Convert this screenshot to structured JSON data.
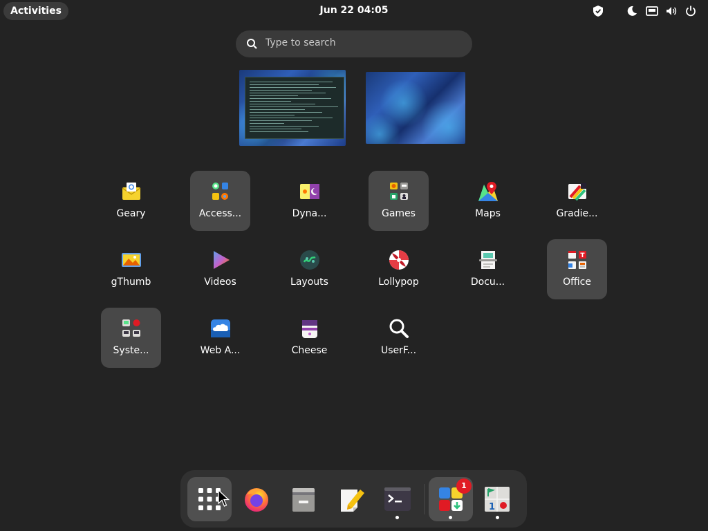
{
  "topbar": {
    "activities_label": "Activities",
    "clock": "Jun 22  04:05",
    "tray_icons": [
      "shield-icon",
      "night-light-icon",
      "network-icon",
      "volume-icon",
      "power-icon"
    ]
  },
  "search": {
    "placeholder": "Type to search"
  },
  "windows": [
    "terminal-window-thumbnail",
    "desktop-window-thumbnail"
  ],
  "app_grid": {
    "rows": [
      [
        {
          "label": "Geary",
          "icon": "geary-icon",
          "folder": false
        },
        {
          "label": "Access...",
          "icon": "accessories-folder-icon",
          "folder": true
        },
        {
          "label": "Dyna...",
          "icon": "dynamic-wallpaper-icon",
          "folder": false
        },
        {
          "label": "Games",
          "icon": "games-folder-icon",
          "folder": true
        },
        {
          "label": "Maps",
          "icon": "maps-icon",
          "folder": false
        },
        {
          "label": "Gradie...",
          "icon": "gradience-icon",
          "folder": false
        }
      ],
      [
        {
          "label": "gThumb",
          "icon": "gthumb-icon",
          "folder": false
        },
        {
          "label": "Videos",
          "icon": "videos-icon",
          "folder": false
        },
        {
          "label": "Layouts",
          "icon": "layouts-icon",
          "folder": false
        },
        {
          "label": "Lollypop",
          "icon": "lollypop-icon",
          "folder": false
        },
        {
          "label": "Docu...",
          "icon": "document-scanner-icon",
          "folder": false
        },
        {
          "label": "Office",
          "icon": "office-folder-icon",
          "folder": true
        }
      ],
      [
        {
          "label": "Syste...",
          "icon": "system-folder-icon",
          "folder": true
        },
        {
          "label": "Web A...",
          "icon": "web-apps-icon",
          "folder": false
        },
        {
          "label": "Cheese",
          "icon": "cheese-icon",
          "folder": false
        },
        {
          "label": "UserF...",
          "icon": "userfinder-icon",
          "folder": false
        }
      ]
    ]
  },
  "dock": {
    "items": [
      {
        "name": "show-apps-button",
        "icon": "app-grid-icon",
        "running": false
      },
      {
        "name": "firefox",
        "icon": "firefox-icon",
        "running": false
      },
      {
        "name": "files",
        "icon": "files-icon",
        "running": false
      },
      {
        "name": "text-editor",
        "icon": "text-editor-icon",
        "running": false
      },
      {
        "name": "terminal",
        "icon": "terminal-icon",
        "running": true
      },
      {
        "name": "software",
        "icon": "software-icon",
        "running": true,
        "badge": "1"
      },
      {
        "name": "tour",
        "icon": "tour-icon",
        "running": true
      }
    ]
  },
  "colors": {
    "background": "#232323",
    "folder_tile": "#484848",
    "badge": "#e01b24"
  }
}
